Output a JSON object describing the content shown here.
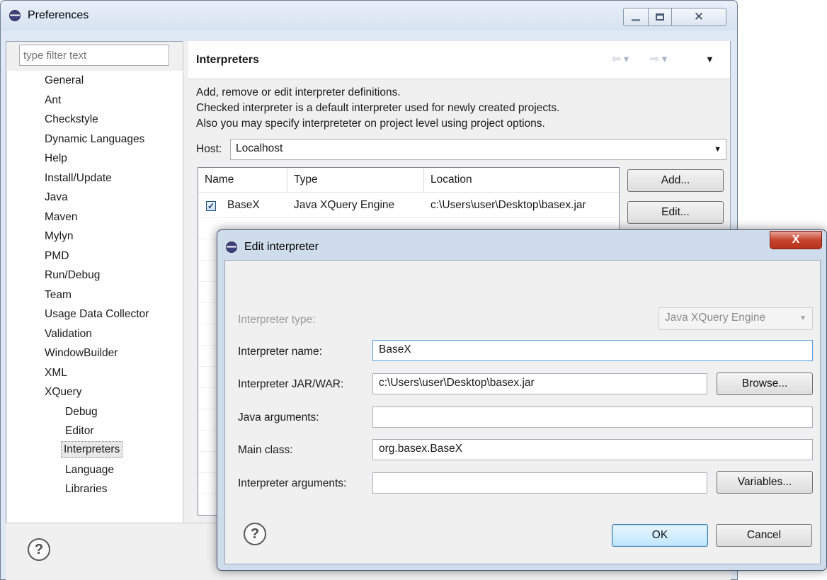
{
  "prefs": {
    "title": "Preferences",
    "filter_placeholder": "type filter text",
    "tree": [
      {
        "label": "General",
        "indent": 0
      },
      {
        "label": "Ant",
        "indent": 0
      },
      {
        "label": "Checkstyle",
        "indent": 0
      },
      {
        "label": "Dynamic Languages",
        "indent": 0
      },
      {
        "label": "Help",
        "indent": 0
      },
      {
        "label": "Install/Update",
        "indent": 0
      },
      {
        "label": "Java",
        "indent": 0
      },
      {
        "label": "Maven",
        "indent": 0
      },
      {
        "label": "Mylyn",
        "indent": 0
      },
      {
        "label": "PMD",
        "indent": 0
      },
      {
        "label": "Run/Debug",
        "indent": 0
      },
      {
        "label": "Team",
        "indent": 0
      },
      {
        "label": "Usage Data Collector",
        "indent": 0
      },
      {
        "label": "Validation",
        "indent": 0
      },
      {
        "label": "WindowBuilder",
        "indent": 0
      },
      {
        "label": "XML",
        "indent": 0
      },
      {
        "label": "XQuery",
        "indent": 0
      },
      {
        "label": "Debug",
        "indent": 1
      },
      {
        "label": "Editor",
        "indent": 1
      },
      {
        "label": "Interpreters",
        "indent": 1,
        "selected": true
      },
      {
        "label": "Language",
        "indent": 1
      },
      {
        "label": "Libraries",
        "indent": 1
      }
    ],
    "page_title": "Interpreters",
    "description": [
      "Add, remove or edit interpreter definitions.",
      "Checked interpreter is a default interpreter used for newly created projects.",
      "Also you may specify interpreteter on project level using project options."
    ],
    "host_label": "Host:",
    "host_value": "Localhost",
    "table": {
      "columns": [
        "Name",
        "Type",
        "Location"
      ],
      "rows": [
        {
          "checked": true,
          "name": "BaseX",
          "type": "Java XQuery Engine",
          "location": "c:\\Users\\user\\Desktop\\basex.jar"
        }
      ]
    },
    "buttons": {
      "add": "Add...",
      "edit": "Edit..."
    }
  },
  "dialog": {
    "title": "Edit interpreter",
    "close_glyph": "X",
    "type_label": "Interpreter type:",
    "type_value": "Java XQuery Engine",
    "name_label": "Interpreter name:",
    "name_value": "BaseX",
    "jar_label": "Interpreter JAR/WAR:",
    "jar_value": "c:\\Users\\user\\Desktop\\basex.jar",
    "browse_label": "Browse...",
    "java_args_label": "Java arguments:",
    "java_args_value": "",
    "main_class_label": "Main class:",
    "main_class_value": "org.basex.BaseX",
    "interp_args_label": "Interpreter arguments:",
    "interp_args_value": "",
    "variables_label": "Variables...",
    "ok_label": "OK",
    "cancel_label": "Cancel"
  },
  "icons": [
    "eclipse-logo-icon",
    "minimize-icon",
    "maximize-icon",
    "close-icon",
    "back-arrow-icon",
    "forward-arrow-icon",
    "view-menu-icon",
    "help-icon",
    "checkbox-icon",
    "dropdown-arrow-icon"
  ]
}
